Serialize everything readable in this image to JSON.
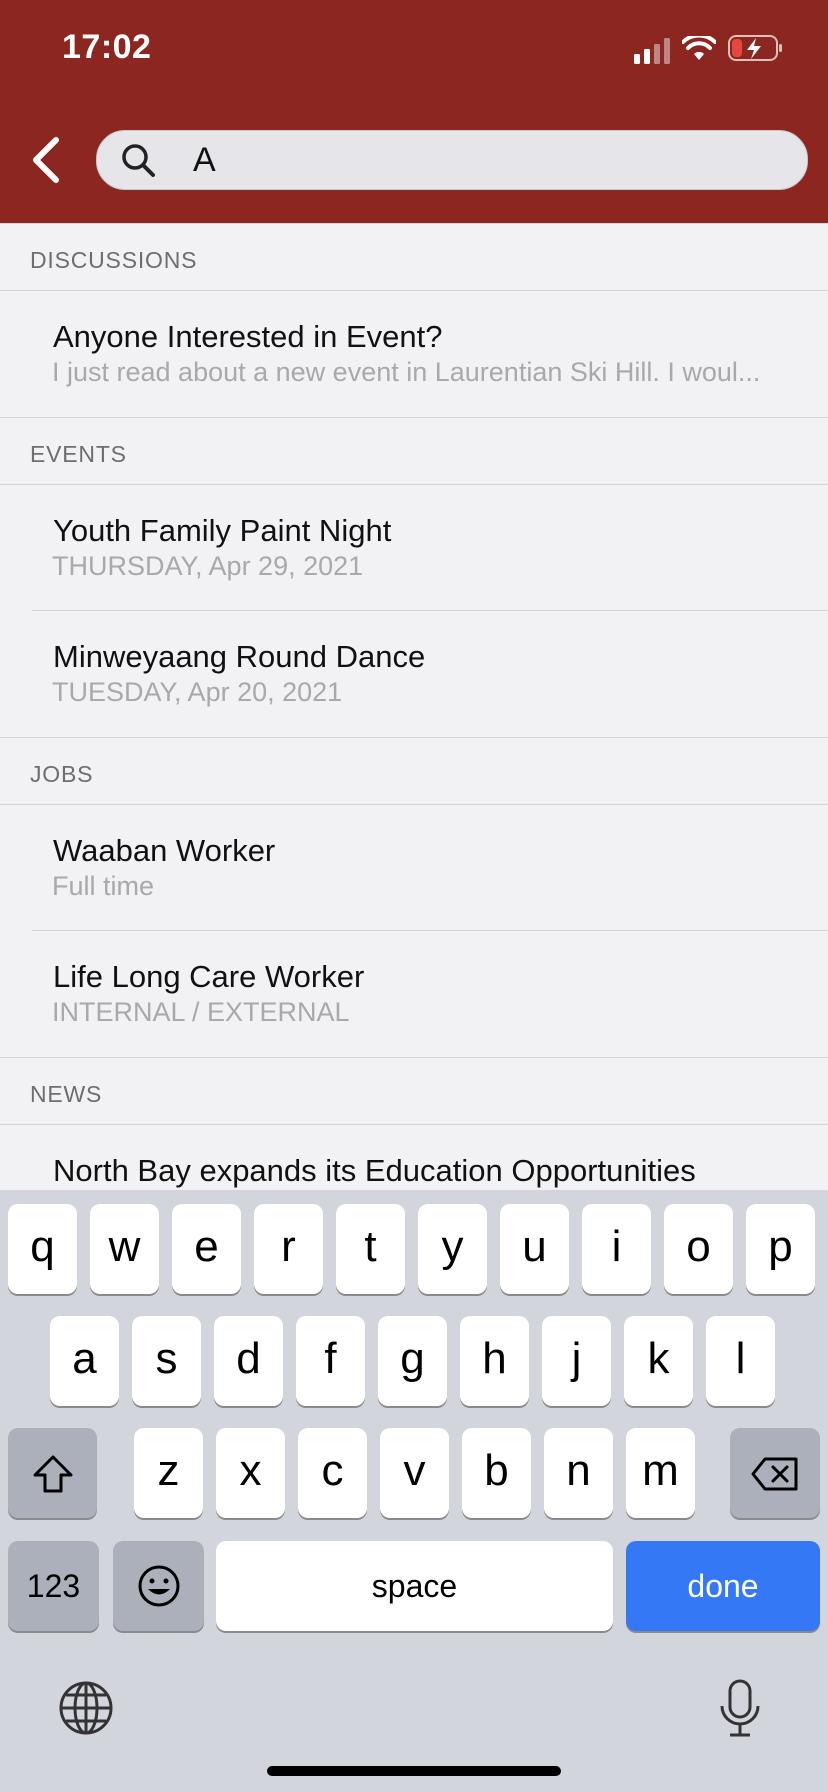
{
  "status_bar": {
    "time": "17:02"
  },
  "search": {
    "value": "A"
  },
  "sections": [
    {
      "header": "DISCUSSIONS",
      "items": [
        {
          "title": "Anyone Interested in Event?",
          "subtitle": "I just read about a new event in Laurentian Ski Hill. I woul..."
        }
      ]
    },
    {
      "header": "EVENTS",
      "items": [
        {
          "title": "Youth Family Paint Night",
          "subtitle": "THURSDAY, Apr 29, 2021"
        },
        {
          "title": "Minweyaang Round Dance",
          "subtitle": "TUESDAY, Apr 20, 2021"
        }
      ]
    },
    {
      "header": "JOBS",
      "items": [
        {
          "title": "Waaban Worker",
          "subtitle": "Full time"
        },
        {
          "title": "Life Long Care Worker",
          "subtitle": "INTERNAL / EXTERNAL"
        }
      ]
    },
    {
      "header": "NEWS",
      "items": [
        {
          "title": "North Bay expands its Education  Opportunities",
          "subtitle": ""
        }
      ]
    }
  ],
  "keyboard": {
    "row1": [
      "q",
      "w",
      "e",
      "r",
      "t",
      "y",
      "u",
      "i",
      "o",
      "p"
    ],
    "row2": [
      "a",
      "s",
      "d",
      "f",
      "g",
      "h",
      "j",
      "k",
      "l"
    ],
    "row3": [
      "z",
      "x",
      "c",
      "v",
      "b",
      "n",
      "m"
    ],
    "numbers_label": "123",
    "space_label": "space",
    "done_label": "done"
  },
  "colors": {
    "header": "#8b2620",
    "done_key": "#3478f6",
    "battery": "#e5463d"
  },
  "icons": [
    "back-chevron-icon",
    "search-icon",
    "signal-icon",
    "wifi-icon",
    "battery-charging-icon",
    "shift-icon",
    "delete-icon",
    "emoji-icon",
    "globe-icon",
    "microphone-icon"
  ]
}
